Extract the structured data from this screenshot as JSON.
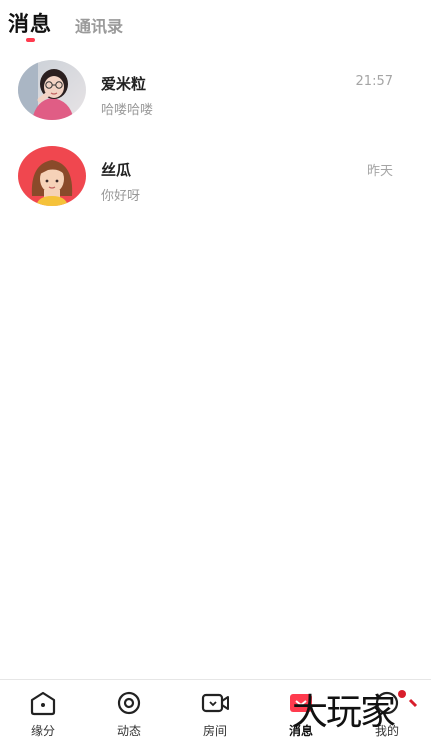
{
  "header": {
    "active_tab": "消息",
    "inactive_tab": "通讯录",
    "accent": "#ff3b4e"
  },
  "conversations": [
    {
      "name": "爱米粒",
      "preview": "哈喽哈喽",
      "time": "21:57",
      "avatar": "photo-avatar"
    },
    {
      "name": "丝瓜",
      "preview": "你好呀",
      "time": "昨天",
      "avatar": "cartoon-girl-avatar"
    }
  ],
  "tabbar": {
    "items": [
      {
        "label": "缘分",
        "icon": "home-icon"
      },
      {
        "label": "动态",
        "icon": "circle-eye-icon"
      },
      {
        "label": "房间",
        "icon": "video-camera-icon"
      },
      {
        "label": "消息",
        "icon": "message-icon",
        "active": true
      },
      {
        "label": "我的",
        "icon": "profile-icon"
      }
    ]
  },
  "watermark": {
    "text": "大玩家",
    "color": "#d81e2c"
  }
}
